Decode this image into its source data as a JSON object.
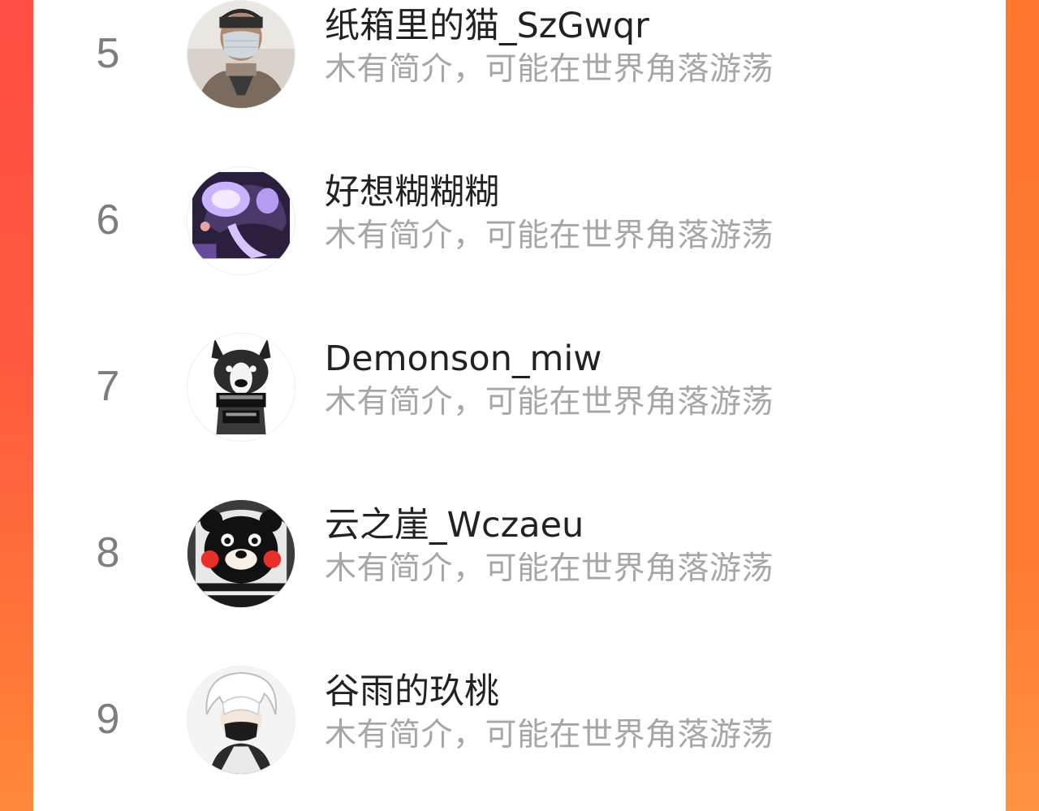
{
  "colors": {
    "background_gradient_top": "#ff4d43",
    "background_gradient_bottom": "#ff8a3a",
    "card": "#ffffff",
    "rank_text": "#7d7d7d",
    "name_text": "#222222",
    "bio_text": "#a6a6a6"
  },
  "ranking": {
    "items": [
      {
        "rank": "5",
        "name": "纸箱里的猫_SzGwqr",
        "bio": "木有简介，可能在世界角落游荡",
        "avatar_icon": "masked-man-avatar"
      },
      {
        "rank": "6",
        "name": "好想糊糊糊",
        "bio": "木有简介，可能在世界角落游荡",
        "avatar_icon": "purple-lamp-avatar"
      },
      {
        "rank": "7",
        "name": "Demonson_miw",
        "bio": "木有简介，可能在世界角落游荡",
        "avatar_icon": "bulldog-avatar"
      },
      {
        "rank": "8",
        "name": "云之崖_Wczaeu",
        "bio": "木有简介，可能在世界角落游荡",
        "avatar_icon": "kumamon-avatar"
      },
      {
        "rank": "9",
        "name": "谷雨的玖桃",
        "bio": "木有简介，可能在世界角落游荡",
        "avatar_icon": "white-hair-anime-avatar"
      }
    ]
  }
}
